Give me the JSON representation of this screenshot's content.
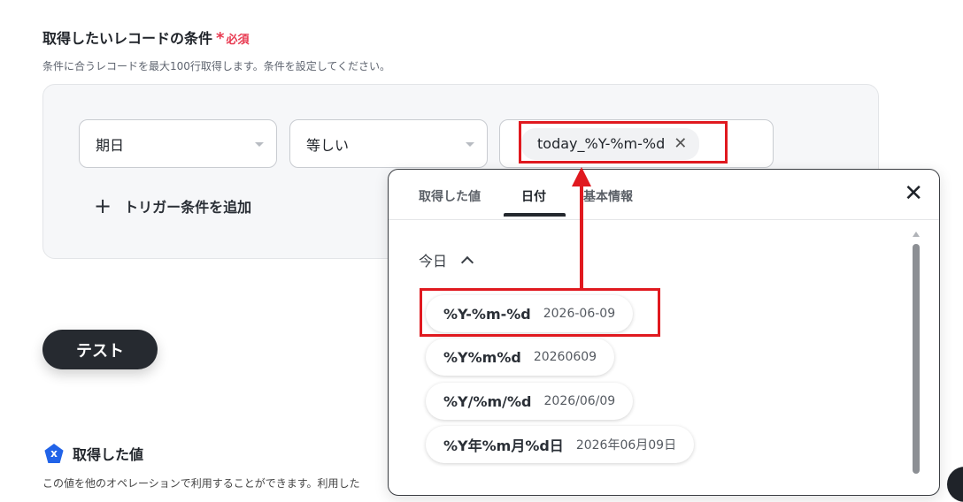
{
  "section": {
    "title": "取得したいレコードの条件",
    "required_mark": "*",
    "required_text": "必須",
    "description": "条件に合うレコードを最大100行取得します。条件を設定してください。"
  },
  "condition": {
    "field_select": "期日",
    "operator_select": "等しい",
    "value_token": "today_%Y-%m-%d",
    "token_remove": "✕",
    "add_trigger_plus": "+",
    "add_trigger_label": "トリガー条件を追加"
  },
  "test_button": "テスト",
  "acquired": {
    "icon_text": "x",
    "title": "取得した値",
    "description": "この値を他のオペレーションで利用することができます。利用した"
  },
  "popup": {
    "tabs": [
      "取得した値",
      "日付",
      "基本情報"
    ],
    "active_tab": "日付",
    "close": "✕",
    "group_label": "今日",
    "formats": [
      {
        "code": "%Y-%m-%d",
        "sample": "2026-06-09"
      },
      {
        "code": "%Y%m%d",
        "sample": "20260609"
      },
      {
        "code": "%Y/%m/%d",
        "sample": "2026/06/09"
      },
      {
        "code": "%Y年%m月%d日",
        "sample": "2026年06月09日"
      }
    ]
  },
  "colors": {
    "required": "#e8384f",
    "highlight": "#e0191f",
    "button_dark": "#262a30",
    "brand_blue": "#2163e8"
  }
}
